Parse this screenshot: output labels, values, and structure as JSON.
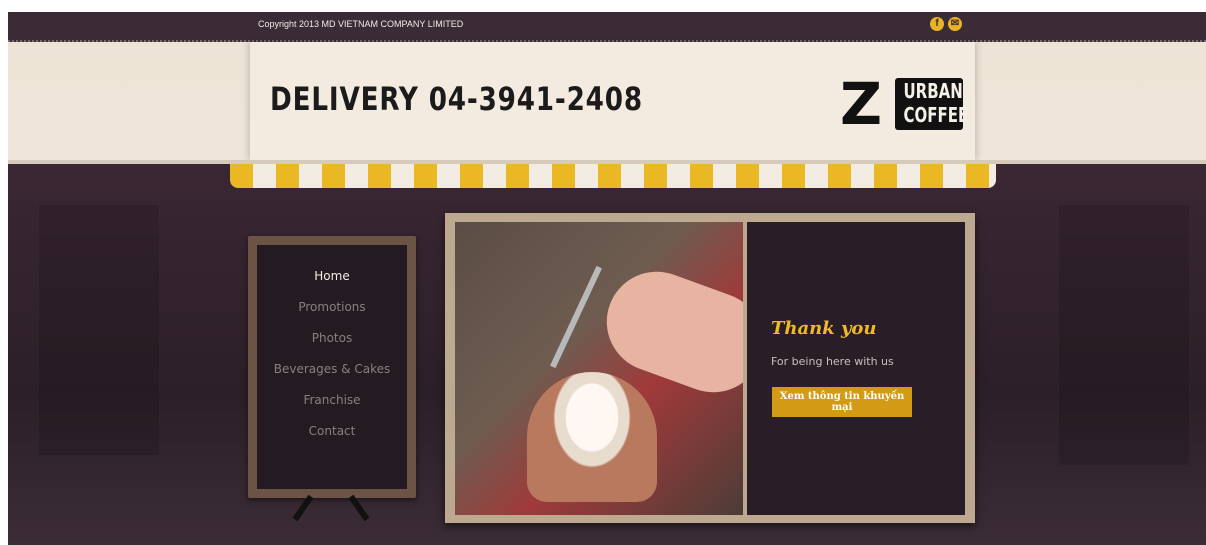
{
  "topbar": {
    "copyright": "Copyright 2013 MD VIETNAM COMPANY LIMITED",
    "social": [
      {
        "icon": "facebook-icon",
        "glyph": "f"
      },
      {
        "icon": "email-icon",
        "glyph": "✉"
      }
    ]
  },
  "header": {
    "delivery": "DELIVERY 04-3941-2408",
    "logo": {
      "letter": "Z",
      "line1": "URBAN",
      "line2": "COFFEE"
    }
  },
  "nav": {
    "items": [
      "Home",
      "Promotions",
      "Photos",
      "Beverages & Cakes",
      "Franchise",
      "Contact"
    ],
    "active_index": 0
  },
  "promo": {
    "title": "Thank you",
    "subtitle": "For being here with us",
    "button_label": "Xem thông tin khuyến mại"
  },
  "colors": {
    "accent": "#d39a15",
    "dark": "#2a1e26",
    "topbar": "#3b2b36"
  }
}
